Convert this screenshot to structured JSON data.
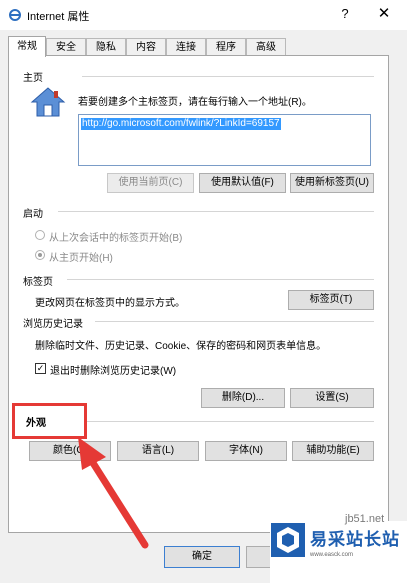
{
  "window": {
    "title": "Internet 属性",
    "help": "?",
    "close": "✕"
  },
  "tabs": [
    "常规",
    "安全",
    "隐私",
    "内容",
    "连接",
    "程序",
    "高级"
  ],
  "home": {
    "heading": "主页",
    "description": "若要创建多个主标签页，请在每行输入一个地址(R)。",
    "url": "http://go.microsoft.com/fwlink/?LinkId=69157",
    "buttons": {
      "use_current": "使用当前页(C)",
      "use_default": "使用默认值(F)",
      "use_new_tab": "使用新标签页(U)"
    }
  },
  "startup": {
    "heading": "启动",
    "option_last_session": "从上次会话中的标签页开始(B)",
    "option_home": "从主页开始(H)"
  },
  "tabs_section": {
    "heading": "标签页",
    "description": "更改网页在标签页中的显示方式。",
    "button": "标签页(T)"
  },
  "history": {
    "heading": "浏览历史记录",
    "description": "删除临时文件、历史记录、Cookie、保存的密码和网页表单信息。",
    "checkbox_label": "退出时删除浏览历史记录(W)",
    "checked": true,
    "delete_button": "删除(D)...",
    "settings_button": "设置(S)"
  },
  "appearance": {
    "heading": "外观",
    "colors_button": "颜色(C)",
    "languages_button": "语言(L)",
    "fonts_button": "字体(N)",
    "accessibility_button": "辅助功能(E)"
  },
  "footer": {
    "ok_button": "确定"
  },
  "watermark": {
    "site_name": "易采站长站",
    "url_top": "jb51.net",
    "url": "www.easck.com"
  },
  "colors": {
    "annotation_red": "#e53935",
    "selection_blue": "#3399ff",
    "icon_blue": "#2e6fc0"
  }
}
